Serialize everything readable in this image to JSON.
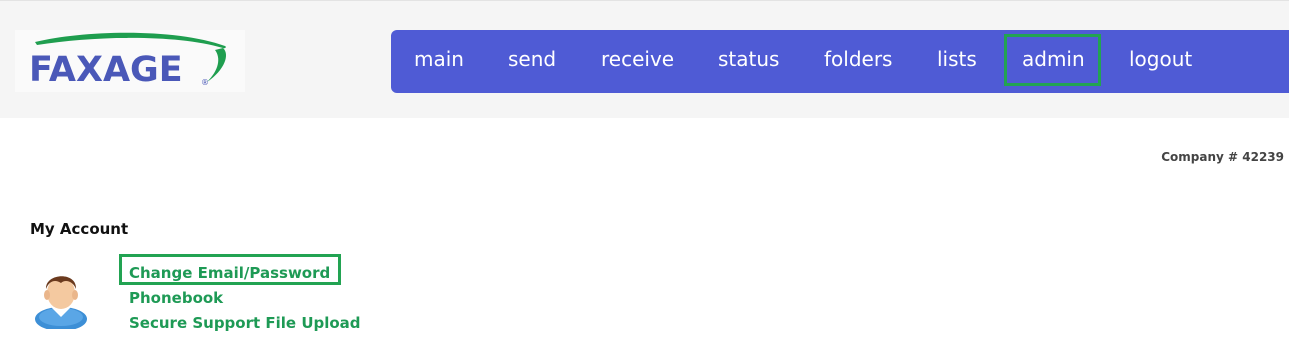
{
  "logo": {
    "text": "FAXAGE",
    "reg": "®"
  },
  "nav": {
    "items": [
      {
        "label": "main"
      },
      {
        "label": "send"
      },
      {
        "label": "receive"
      },
      {
        "label": "status"
      },
      {
        "label": "folders"
      },
      {
        "label": "lists"
      },
      {
        "label": "admin"
      },
      {
        "label": "logout"
      }
    ]
  },
  "company": "Company # 42239",
  "account": {
    "title": "My Account",
    "links": [
      {
        "label": "Change Email/Password"
      },
      {
        "label": "Phonebook"
      },
      {
        "label": "Secure Support File Upload"
      }
    ]
  },
  "colors": {
    "nav_bg": "#4f5bd5",
    "logo_blue": "#4a58b8",
    "logo_green": "#1f9e4f",
    "link_green": "#1e9a55",
    "highlight_green": "#22a352"
  }
}
